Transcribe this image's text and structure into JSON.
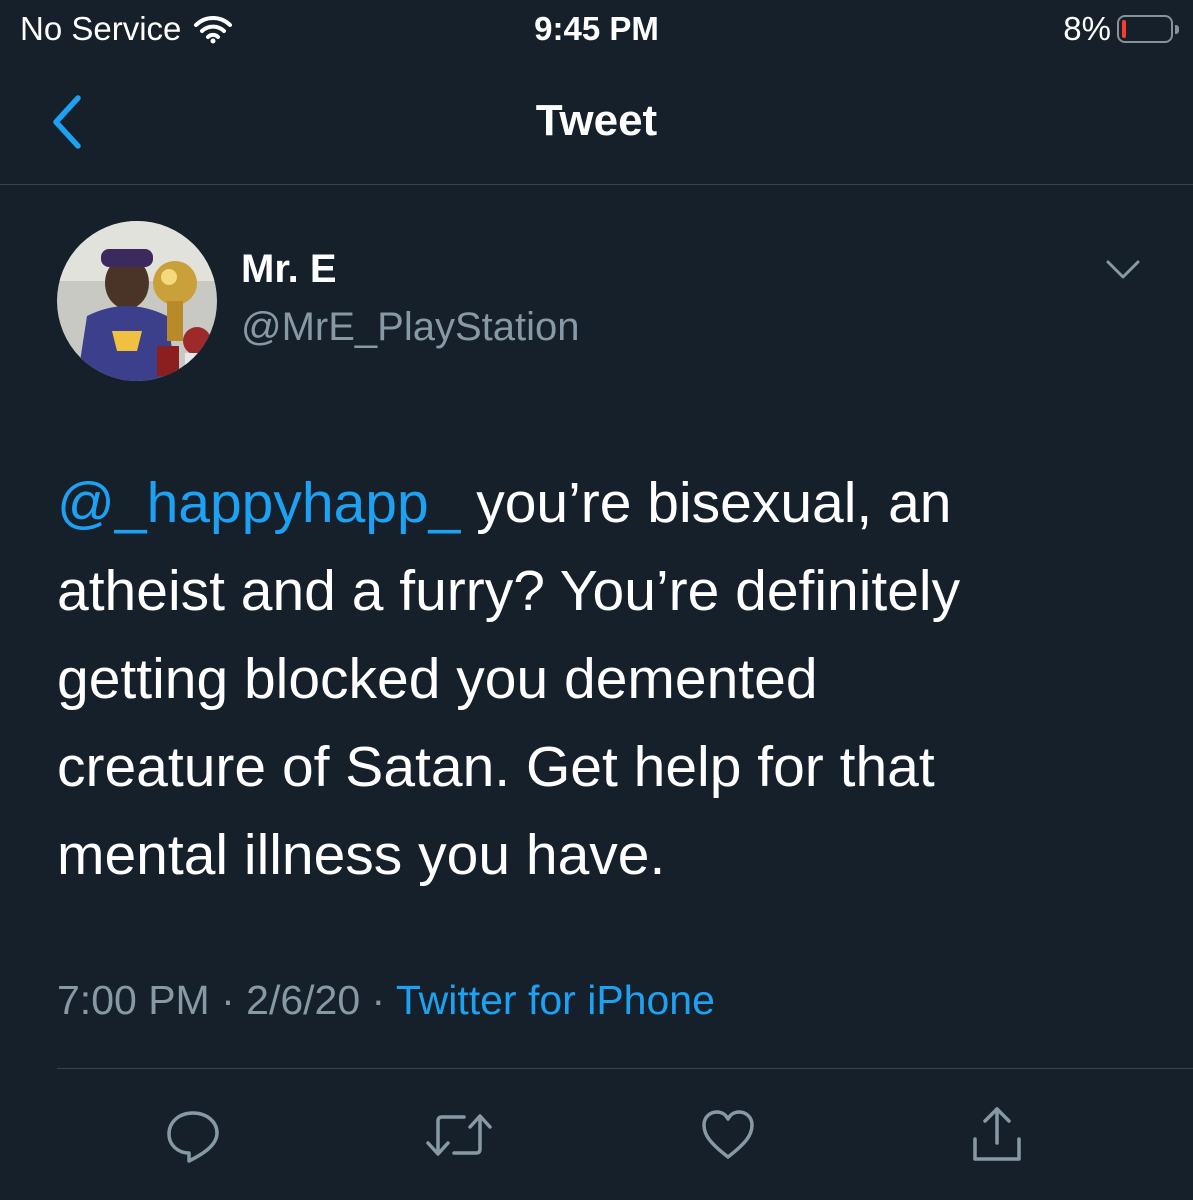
{
  "status_bar": {
    "carrier": "No Service",
    "time": "9:45 PM",
    "battery_percent": "8%",
    "battery_level": 0.08,
    "battery_color": "#ff3b30"
  },
  "nav": {
    "back_icon": "chevron-left-icon",
    "title": "Tweet"
  },
  "tweet": {
    "author_name": "Mr. E",
    "author_handle": "@MrE_PlayStation",
    "mention": "@_happyhapp_",
    "text_lines": [
      " you’re bisexual, an",
      "atheist and a furry? You’re definitely",
      "getting blocked you demented",
      "creature of Satan. Get help for that",
      "mental illness you have."
    ],
    "time": "7:00 PM",
    "separator": " · ",
    "date": "2/6/20",
    "source": "Twitter for iPhone"
  },
  "actions": [
    {
      "name": "reply",
      "icon": "reply-icon"
    },
    {
      "name": "retweet",
      "icon": "retweet-icon"
    },
    {
      "name": "like",
      "icon": "heart-icon"
    },
    {
      "name": "share",
      "icon": "share-icon"
    }
  ],
  "colors": {
    "background": "#15202b",
    "accent": "#1da1f2",
    "secondary_text": "#8899a6",
    "divider": "#38444d"
  }
}
